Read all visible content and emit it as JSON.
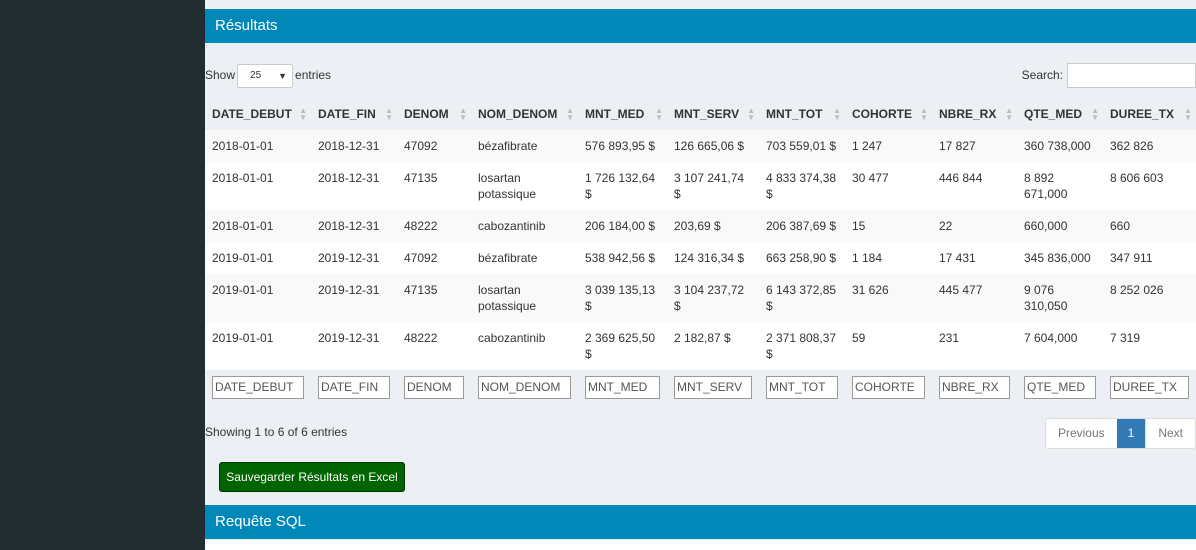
{
  "results_header": {
    "title": "Résultats"
  },
  "length": {
    "show": "Show",
    "value": "25",
    "entries": "entries"
  },
  "search": {
    "label": "Search:",
    "value": ""
  },
  "table": {
    "columns": [
      "DATE_DEBUT",
      "DATE_FIN",
      "DENOM",
      "NOM_DENOM",
      "MNT_MED",
      "MNT_SERV",
      "MNT_TOT",
      "COHORTE",
      "NBRE_RX",
      "QTE_MED",
      "DUREE_TX"
    ],
    "rows": [
      [
        "2018-01-01",
        "2018-12-31",
        "47092",
        "bézafibrate",
        "576 893,95 $",
        "126 665,06 $",
        "703 559,01 $",
        "1 247",
        "17 827",
        "360 738,000",
        "362 826"
      ],
      [
        "2018-01-01",
        "2018-12-31",
        "47135",
        "losartan potassique",
        "1 726 132,64 $",
        "3 107 241,74 $",
        "4 833 374,38 $",
        "30 477",
        "446 844",
        "8 892 671,000",
        "8 606 603"
      ],
      [
        "2018-01-01",
        "2018-12-31",
        "48222",
        "cabozantinib",
        "206 184,00 $",
        "203,69 $",
        "206 387,69 $",
        "15",
        "22",
        "660,000",
        "660"
      ],
      [
        "2019-01-01",
        "2019-12-31",
        "47092",
        "bézafibrate",
        "538 942,56 $",
        "124 316,34 $",
        "663 258,90 $",
        "1 184",
        "17 431",
        "345 836,000",
        "347 911"
      ],
      [
        "2019-01-01",
        "2019-12-31",
        "47135",
        "losartan potassique",
        "3 039 135,13 $",
        "3 104 237,72 $",
        "6 143 372,85 $",
        "31 626",
        "445 477",
        "9 076 310,050",
        "8 252 026"
      ],
      [
        "2019-01-01",
        "2019-12-31",
        "48222",
        "cabozantinib",
        "2 369 625,50 $",
        "2 182,87 $",
        "2 371 808,37 $",
        "59",
        "231",
        "7 604,000",
        "7 319"
      ]
    ],
    "filter_placeholders": [
      "DATE_DEBUT",
      "DATE_FIN",
      "DENOM",
      "NOM_DENOM",
      "MNT_MED",
      "MNT_SERV",
      "MNT_TOT",
      "COHORTE",
      "NBRE_RX",
      "QTE_MED",
      "DUREE_TX"
    ]
  },
  "info": "Showing 1 to 6 of 6 entries",
  "pagination": {
    "previous": "Previous",
    "current": "1",
    "next": "Next"
  },
  "export_button": "Sauvegarder Résultats en Excel",
  "sql_header": {
    "title": "Requête SQL"
  },
  "colors": {
    "sidebar": "#222d32",
    "header": "#0088b9",
    "excel": "#006400",
    "page_active": "#337ab7"
  }
}
